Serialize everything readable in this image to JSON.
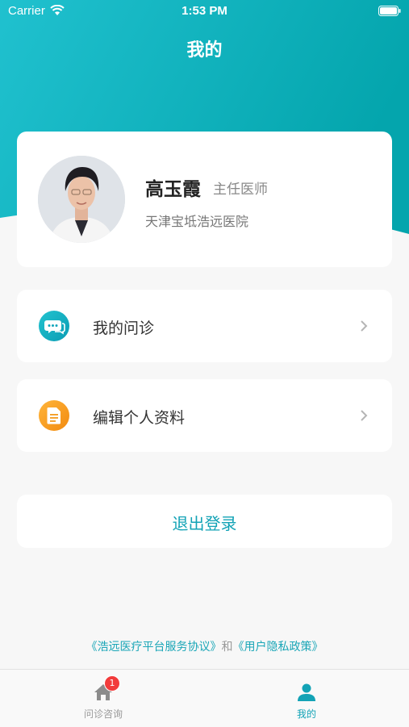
{
  "status_bar": {
    "carrier": "Carrier",
    "time": "1:53 PM"
  },
  "header": {
    "title": "我的"
  },
  "profile": {
    "name": "高玉霞",
    "title": "主任医师",
    "hospital": "天津宝坻浩远医院"
  },
  "menu": [
    {
      "label": "我的问诊",
      "icon": "chat-bubble-icon"
    },
    {
      "label": "编辑个人资料",
      "icon": "document-icon"
    }
  ],
  "logout": {
    "label": "退出登录"
  },
  "agreements": {
    "service": "《浩远医疗平台服务协议》",
    "and": "和",
    "privacy": "《用户隐私政策》"
  },
  "tabbar": {
    "tabs": [
      {
        "label": "问诊咨询",
        "badge": "1",
        "icon": "home-icon"
      },
      {
        "label": "我的",
        "icon": "person-icon"
      }
    ]
  },
  "colors": {
    "accent": "#13a3b6",
    "header_gradient_start": "#1fb8cf",
    "header_gradient_end": "#05a7ad",
    "badge": "#f23b3b"
  }
}
